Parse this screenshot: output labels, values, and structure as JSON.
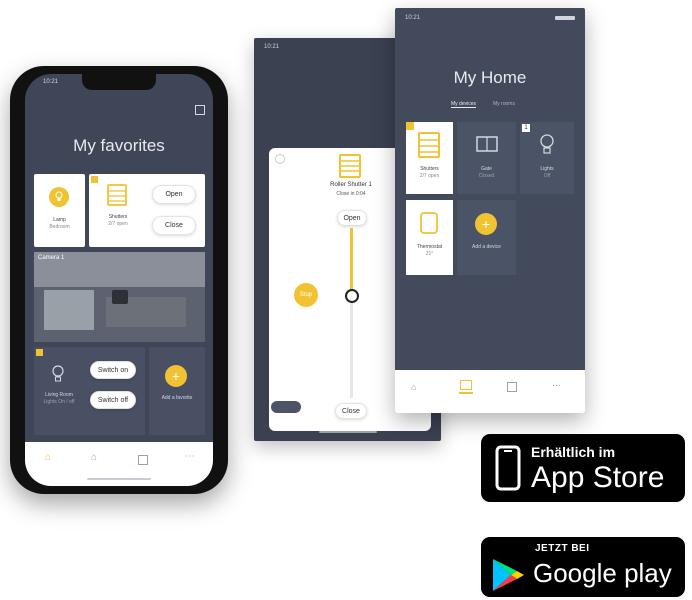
{
  "roller_screen": {
    "status_time": "10:21",
    "device_name": "Roller Shutter 1",
    "device_sub": "Close in 0:04",
    "open_label": "Open",
    "close_label": "Close",
    "stop_label": "Stop"
  },
  "home_screen": {
    "status_time": "10:21",
    "title": "My Home",
    "tab_devices": "My devices",
    "tab_rooms": "My rooms",
    "tiles": [
      {
        "label": "Shutters",
        "sub": "2/7 open"
      },
      {
        "label": "Gate",
        "sub": "Closed"
      },
      {
        "label": "Lights",
        "sub": "Off"
      },
      {
        "label": "Thermostat",
        "sub": "21°"
      },
      {
        "label": "Add a device",
        "sub": ""
      }
    ],
    "light_badge_count": "1"
  },
  "favorites_screen": {
    "status_time": "10:21",
    "title": "My favorites",
    "lamp_label": "Lamp",
    "lamp_sub": "Bedroom",
    "shutter_label": "Shutters",
    "shutter_sub": "2/7 open",
    "open_label": "Open",
    "close_label": "Close",
    "camera_label": "Camera 1",
    "living_room_label": "Living Room",
    "living_room_sub": "Lights On / off",
    "switch_on_label": "Switch on",
    "switch_off_label": "Switch off",
    "add_favorite_label": "Add a favorite"
  },
  "badges": {
    "appstore_line1": "Erhältlich im",
    "appstore_line2": "App Store",
    "googleplay_line1": "JETZT BEI",
    "googleplay_line2": "Google play"
  },
  "colors": {
    "accent": "#f1c232",
    "phone_bg": "#3f4658",
    "tile_white": "#ffffff"
  }
}
